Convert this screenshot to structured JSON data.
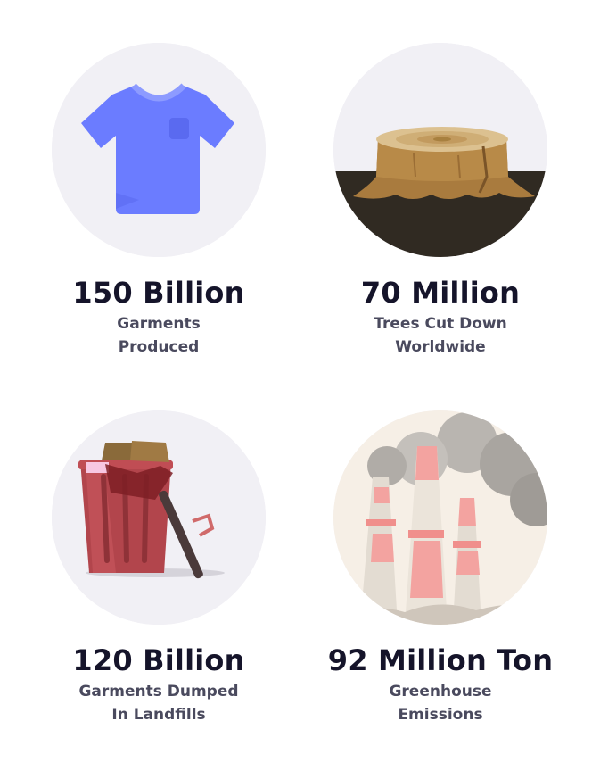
{
  "stats": [
    {
      "value": "150 Billion",
      "label": "Garments\nProduced",
      "icon": "t-shirt-icon"
    },
    {
      "value": "70 Million",
      "label": "Trees Cut Down\nWorldwide",
      "icon": "tree-stump-icon"
    },
    {
      "value": "120 Billion",
      "label": "Garments Dumped\nIn Landfills",
      "icon": "trash-bin-icon"
    },
    {
      "value": "92 Million Ton",
      "label": "Greenhouse\nEmissions",
      "icon": "factory-chimneys-icon"
    }
  ],
  "colors": {
    "circle_bg": "#f1f0f5",
    "value_text": "#15142a",
    "label_text": "#4a4a5e",
    "shirt": "#6b7cff",
    "stump": "#b88a48",
    "ground": "#302a22",
    "bin": "#b2454c",
    "chimney_stripe": "#f3a3a0",
    "smoke": "#a9a5a0"
  }
}
